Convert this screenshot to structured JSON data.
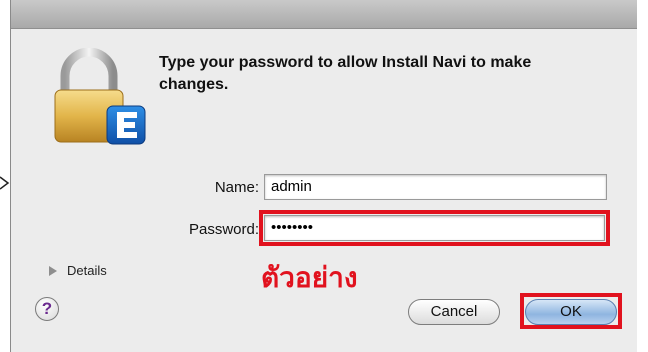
{
  "dialog": {
    "message": "Type your password to allow Install Navi to make changes.",
    "name_label": "Name:",
    "name_value": "admin",
    "password_label": "Password:",
    "password_value": "••••••••",
    "details_label": "Details",
    "help_label": "?",
    "cancel_label": "Cancel",
    "ok_label": "OK"
  },
  "annotation": {
    "example_text": "ตัวอย่าง"
  },
  "icons": {
    "lock": "lock-icon",
    "app_badge": "install-navi-badge-icon"
  },
  "colors": {
    "highlight": "#e1121e",
    "dialog_bg": "#ececec"
  }
}
